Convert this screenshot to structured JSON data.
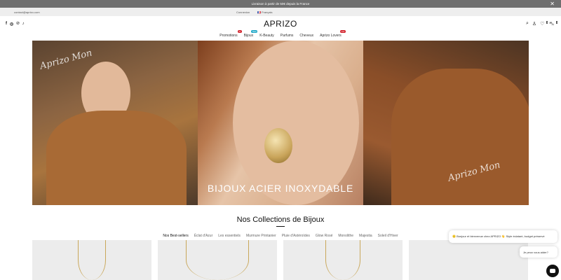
{
  "announcement": {
    "text": "Livraison à partir de 50€ depuis la France",
    "close": "✕"
  },
  "subbar": {
    "email": "contact@aprizo.com",
    "region": "Connexion",
    "language": "Français",
    "flag": "🇫🇷"
  },
  "header": {
    "logo": "APRIZO",
    "social": [
      "f",
      "◎",
      "℗",
      "♪"
    ],
    "icons": {
      "search": "⌕",
      "account": "♙",
      "wishlist": "♡",
      "cart": "⛍"
    },
    "wishlist_count": "0",
    "cart_count": "0"
  },
  "nav": [
    {
      "label": "Promotions",
      "tag": "%",
      "tag_color": "#d2202a"
    },
    {
      "label": "Bijoux",
      "tag": "New",
      "tag_color": "#20a8c8"
    },
    {
      "label": "K-Beauty",
      "tag": "",
      "tag_color": ""
    },
    {
      "label": "Parfums",
      "tag": "",
      "tag_color": ""
    },
    {
      "label": "Cheveux",
      "tag": "",
      "tag_color": ""
    },
    {
      "label": "Aprizo Lovers",
      "tag": "Hot",
      "tag_color": "#d2202a"
    }
  ],
  "hero": {
    "title": "BIJOUX ACIER INOXYDABLE",
    "script_1": "Aprizo Mon",
    "script_2": "Aprizo Mon"
  },
  "collections": {
    "title": "Nos Collections de Bijoux",
    "tabs": [
      "Nos Best-sellers",
      "Éclat d'Azur",
      "Les essentiels",
      "Murmure Printanier",
      "Pluie d'Astéroïdes",
      "Glow Rosé",
      "Monolithe",
      "Majestia",
      "Soleil d'Hiver"
    ]
  },
  "chat": {
    "greeting": "🙂 Bonjour et bienvenue chez APRIZO 👋 Style éclatant, budget préservé",
    "help": "Je peux vous aider?"
  }
}
